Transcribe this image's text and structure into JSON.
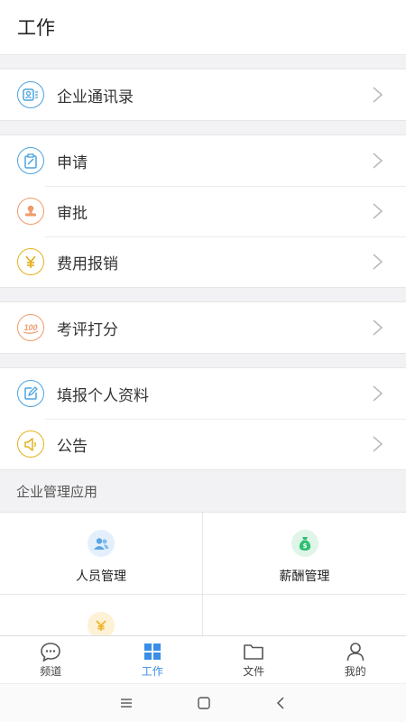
{
  "header": {
    "title": "工作"
  },
  "groups": [
    [
      {
        "label": "企业通讯录",
        "icon": "contacts-icon",
        "color": "#4aa3df"
      }
    ],
    [
      {
        "label": "申请",
        "icon": "apply-icon",
        "color": "#4aa3df"
      },
      {
        "label": "审批",
        "icon": "approval-stamp-icon",
        "color": "#f09a6a"
      },
      {
        "label": "费用报销",
        "icon": "yen-icon",
        "color": "#e2b21c"
      }
    ],
    [
      {
        "label": "考评打分",
        "icon": "score-100-icon",
        "color": "#f09a6a"
      }
    ],
    [
      {
        "label": "填报个人资料",
        "icon": "edit-profile-icon",
        "color": "#4aa3df"
      },
      {
        "label": "公告",
        "icon": "megaphone-icon",
        "color": "#e2b21c"
      }
    ]
  ],
  "apps_section": {
    "title": "企业管理应用",
    "items": [
      {
        "label": "人员管理",
        "icon": "people-icon",
        "color": "#5aa6e6",
        "bg": "#e3f0fb"
      },
      {
        "label": "薪酬管理",
        "icon": "money-bag-icon",
        "color": "#2fbf71",
        "bg": "#dff5e8"
      },
      {
        "label": "",
        "icon": "yen-coin-icon",
        "color": "#f0b429",
        "bg": "#fdf1d6"
      },
      {
        "label": "",
        "icon": "",
        "color": "",
        "bg": ""
      }
    ]
  },
  "tabbar": {
    "items": [
      {
        "label": "频道",
        "icon": "chat-bubble-icon"
      },
      {
        "label": "工作",
        "icon": "grid-icon",
        "active": true
      },
      {
        "label": "文件",
        "icon": "folder-icon"
      },
      {
        "label": "我的",
        "icon": "person-icon"
      }
    ],
    "active_color": "#3a8ee6"
  }
}
